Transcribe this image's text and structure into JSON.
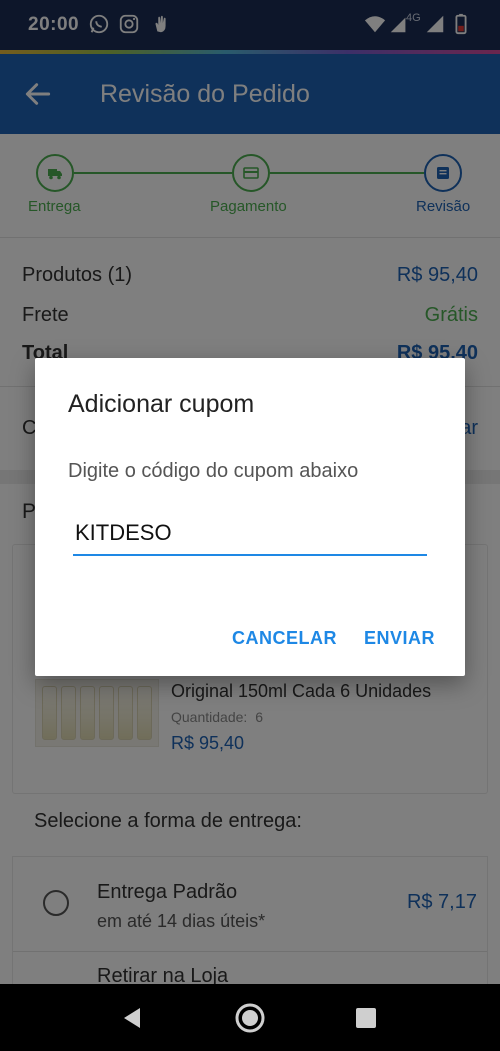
{
  "status_bar": {
    "time": "20:00",
    "icons": [
      "whatsapp-icon",
      "instagram-icon",
      "hand-icon",
      "wifi-icon",
      "signal-4g-icon",
      "signal-icon",
      "battery-low-icon"
    ],
    "network_label": "4G"
  },
  "app_bar": {
    "title": "Revisão do Pedido",
    "back_icon": "arrow-back-icon",
    "color": "#1e62b4"
  },
  "stepper": {
    "steps": [
      {
        "label": "Entrega",
        "icon": "truck-icon",
        "state": "done"
      },
      {
        "label": "Pagamento",
        "icon": "card-icon",
        "state": "done"
      },
      {
        "label": "Revisão",
        "icon": "list-icon",
        "state": "current"
      }
    ],
    "done_color": "#4caf50",
    "current_color": "#1e62b4"
  },
  "summary": {
    "products_label": "Produtos (1)",
    "products_value": "R$ 95,40",
    "shipping_label": "Frete",
    "shipping_value": "Grátis",
    "total_label": "Total",
    "total_value": "R$ 95,40"
  },
  "coupon_row": {
    "label": "C",
    "action": "ar"
  },
  "products_section": {
    "header": "P",
    "item": {
      "name_line": "Original 150ml Cada 6 Unidades",
      "quantity_label": "Quantidade:",
      "quantity_value": "6",
      "price": "R$ 95,40"
    }
  },
  "delivery": {
    "title": "Selecione a forma de entrega:",
    "options": [
      {
        "title": "Entrega Padrão",
        "subtitle": "em até 14 dias úteis*",
        "price": "R$ 7,17"
      },
      {
        "title": "Retirar na Loja"
      }
    ]
  },
  "dialog": {
    "title": "Adicionar cupom",
    "message": "Digite o código do cupom abaixo",
    "input_value": "KITDESO",
    "cancel_label": "CANCELAR",
    "submit_label": "ENVIAR",
    "accent_color": "#1e88e5"
  },
  "nav_bar": {
    "buttons": [
      "back-triangle-icon",
      "home-circle-icon",
      "recents-square-icon"
    ]
  }
}
